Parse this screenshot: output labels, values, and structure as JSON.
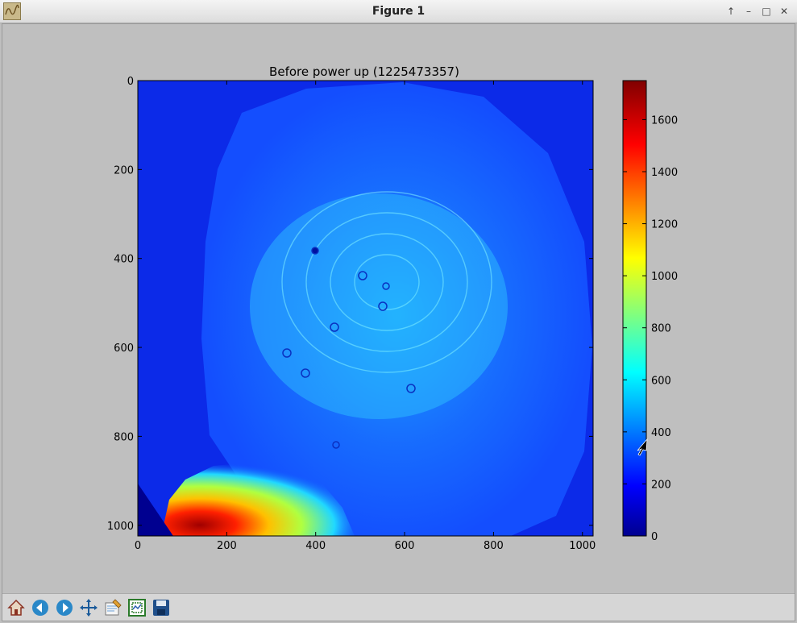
{
  "window": {
    "title": "Figure 1",
    "controls": [
      "↑",
      "–",
      "□",
      "✕"
    ]
  },
  "toolbar": {
    "items": [
      "home-icon",
      "back-icon",
      "forward-icon",
      "pan-icon",
      "configure-subplots-icon",
      "zoom-to-rect-icon",
      "save-icon"
    ]
  },
  "chart_data": {
    "type": "heatmap",
    "title": "Before power up (1225473357)",
    "x_ticks": [
      0,
      200,
      400,
      600,
      800,
      1000
    ],
    "y_ticks": [
      0,
      200,
      400,
      600,
      800,
      1000
    ],
    "xlim": [
      0,
      1024
    ],
    "ylim": [
      1024,
      0
    ],
    "colormap": "jet",
    "colorbar": {
      "range": [
        0,
        1750
      ],
      "ticks": [
        0,
        200,
        400,
        600,
        800,
        1000,
        1200,
        1400,
        1600
      ]
    },
    "features": [
      {
        "name": "background",
        "value": 60
      },
      {
        "name": "illuminated-disc",
        "center": [
          560,
          480
        ],
        "value": 300
      },
      {
        "name": "bright-center",
        "center": [
          540,
          440
        ],
        "value": 520
      },
      {
        "name": "hot-spot",
        "center": [
          180,
          960
        ],
        "value": 1700
      }
    ]
  }
}
